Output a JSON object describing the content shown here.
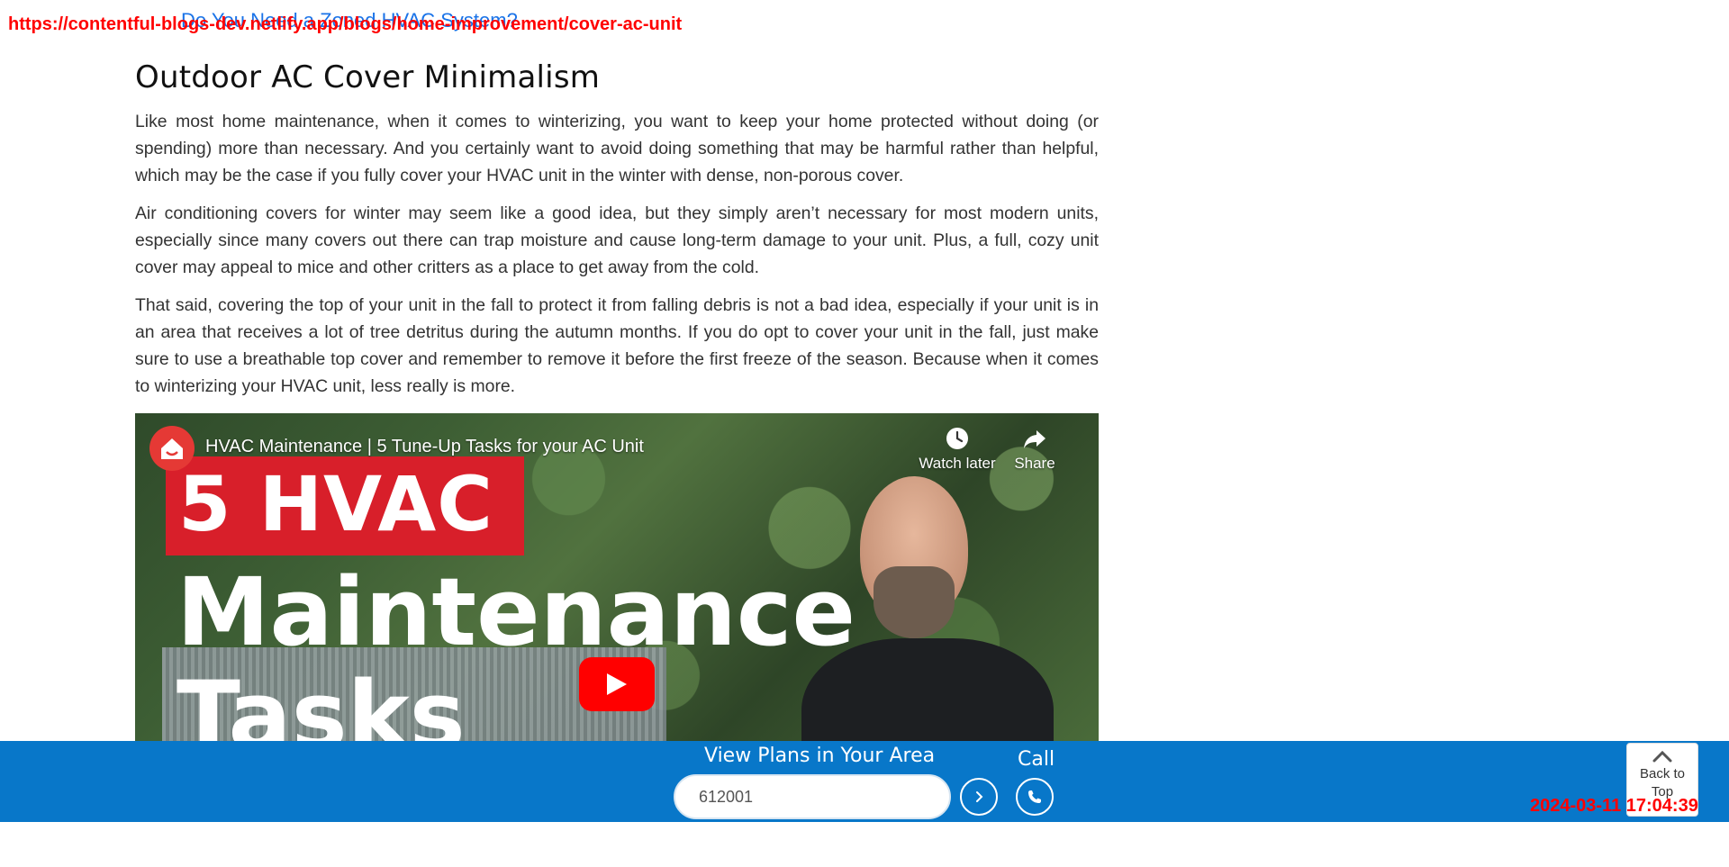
{
  "header": {
    "related_link": "Do You Need a Zoned HVAC System?",
    "url": "https://contentful-blogs-dev.netlify.app/blogs/home-improvement/cover-ac-unit"
  },
  "article": {
    "heading": "Outdoor AC Cover Minimalism",
    "paragraphs": [
      "Like most home maintenance, when it comes to winterizing, you want to keep your home protected without doing (or spending) more than necessary. And you certainly want to avoid doing something that may be harmful rather than helpful, which may be the case if you fully cover your HVAC unit in the winter with dense, non-porous cover.",
      "Air conditioning covers for winter may seem like a good idea, but they simply aren’t necessary for most modern units, especially since many covers out there can trap moisture and cause long-term damage to your unit. Plus, a full, cozy unit cover may appeal to mice and other critters as a place to get away from the cold.",
      "That said, covering the top of your unit in the fall to protect it from falling debris is not a bad idea, especially if your unit is in an area that receives a lot of tree detritus during the autumn months. If you do opt to cover your unit in the fall, just make sure to use a breathable top cover and remember to remove it before the first freeze of the season. Because when it comes to winterizing your HVAC unit, less really is more."
    ]
  },
  "video": {
    "title": "HVAC Maintenance | 5 Tune-Up Tasks for your AC Unit",
    "watch_later": "Watch later",
    "share": "Share",
    "thumb_line1": "5 HVAC",
    "thumb_line2": "Maintenance",
    "thumb_line3": "Tasks"
  },
  "bottom_bar": {
    "plans_title": "View Plans in Your Area",
    "zip_value": "612001",
    "call_label": "Call",
    "back_to_top": "Back to Top",
    "timestamp": "2024-03-11 17:04:39"
  },
  "colors": {
    "accent_blue": "#0877c9",
    "youtube_red": "#ff0000",
    "overlay_red": "#ff0000"
  }
}
